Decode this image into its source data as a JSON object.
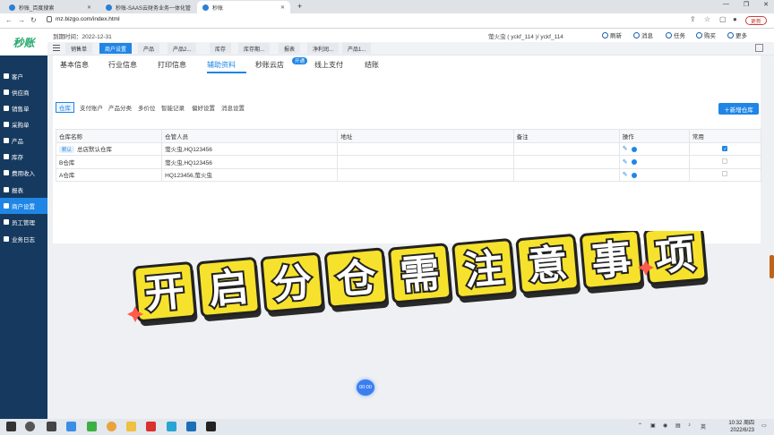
{
  "browser": {
    "tabs": [
      {
        "label": "秒账_百度搜索",
        "active": false
      },
      {
        "label": "秒账-SAAS云财务业务一体化管",
        "active": false
      },
      {
        "label": "秒账",
        "active": true
      }
    ],
    "new_tab": "+",
    "url": "mz.bizgo.com/index.html",
    "update_label": "更新"
  },
  "app": {
    "logo_text": "秒账",
    "expire_text": "到期时间：2022-12-31",
    "user_text": "萤火虫 ( yckf_114 )/ yckf_114",
    "top_actions": [
      "刷新",
      "消息",
      "任务",
      "购买",
      "更多"
    ],
    "open_tabs": [
      "销售单",
      "商户设置",
      "产品",
      "产品2...",
      "库存",
      "库存期...",
      "报表",
      "净利润...",
      "产品1..."
    ],
    "sidebar": [
      "客户",
      "供应商",
      "销售单",
      "采购单",
      "产品",
      "库存",
      "费用收入",
      "报表",
      "商户设置",
      "员工管理",
      "业务日志"
    ],
    "sidebar_active_index": 8
  },
  "settings": {
    "tabs": [
      "基本信息",
      "行业信息",
      "打印信息",
      "辅助资料",
      "秒账云店",
      "线上支付",
      "结账"
    ],
    "active_tab_index": 3,
    "badge": "开通",
    "subtabs": [
      "仓库",
      "支付账户",
      "产品分类",
      "多价位",
      "智能记录",
      "偏好设置",
      "消息设置"
    ],
    "add_button": "新增仓库",
    "table": {
      "headers": [
        "仓库名称",
        "仓管人员",
        "地址",
        "备注",
        "操作",
        "常用"
      ],
      "rows": [
        {
          "tag": "默认",
          "name": "总店默认仓库",
          "keeper": "萤火虫,HQ123456",
          "address": "",
          "note": "",
          "common": true
        },
        {
          "tag": "",
          "name": "B仓库",
          "keeper": "萤火虫,HQ123456",
          "address": "",
          "note": "",
          "common": false
        },
        {
          "tag": "",
          "name": "A仓库",
          "keeper": "HQ123456,萤火虫",
          "address": "",
          "note": "",
          "common": false
        }
      ]
    }
  },
  "overlay": {
    "banner_text": "开启分仓需注意事项",
    "timer": "00:00"
  },
  "taskbar": {
    "time": "10:32 周四",
    "date": "2022/6/23"
  },
  "colors": {
    "accent": "#1f86e6",
    "sidebar": "#163a5f",
    "banner_yellow": "#f6e22c"
  }
}
